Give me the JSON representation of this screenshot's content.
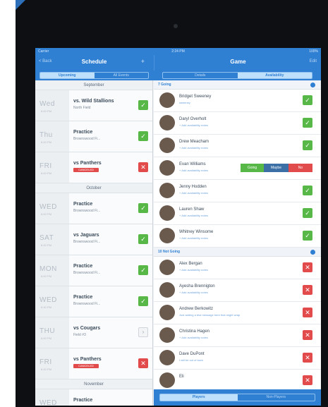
{
  "status": {
    "carrier": "Carrier",
    "time": "2:24 PM",
    "battery": "100%"
  },
  "nav": {
    "back_label": "< Back",
    "schedule_title": "Schedule",
    "add_icon": "plus-icon",
    "game_title": "Game",
    "edit_label": "Edit"
  },
  "schedule_tabs": [
    {
      "label": "Upcoming",
      "active": true
    },
    {
      "label": "All Events",
      "active": false
    }
  ],
  "game_tabs": [
    {
      "label": "Details",
      "active": false
    },
    {
      "label": "Availability",
      "active": true
    }
  ],
  "months": {
    "m1": "September",
    "m2": "October",
    "m3": "November"
  },
  "events": [
    {
      "day": "Wed",
      "time": "6:00 PM",
      "name": "vs. Wild Stallions",
      "loc": "North Field",
      "tag": "",
      "status": "yes"
    },
    {
      "day": "Thu",
      "time": "6:00 PM",
      "name": "Practice",
      "loc": "Brownswood Fi...",
      "tag": "",
      "status": "yes"
    },
    {
      "day": "FRI",
      "time": "6:00 PM",
      "name": "vs Panthers",
      "loc": "",
      "tag": "CANCELED",
      "status": "no"
    },
    {
      "day": "WED",
      "time": "6:00 PM",
      "name": "Practice",
      "loc": "Brownswood Fi...",
      "tag": "",
      "status": "yes"
    },
    {
      "day": "SAT",
      "time": "6:00 PM",
      "name": "vs Jaguars",
      "loc": "Brownswood Fi...",
      "tag": "",
      "status": "yes"
    },
    {
      "day": "MON",
      "time": "6:00 PM",
      "name": "Practice",
      "loc": "Brownswood Fi...",
      "tag": "",
      "status": "yes"
    },
    {
      "day": "WED",
      "time": "6:30 PM",
      "name": "Practice",
      "loc": "Brownswood Fi...",
      "tag": "",
      "status": "yes"
    },
    {
      "day": "THU",
      "time": "6:00 PM",
      "name": "vs Cougars",
      "loc": "Field #3",
      "tag": "",
      "status": "none"
    },
    {
      "day": "FRI",
      "time": "6:00 PM",
      "name": "vs Panthers",
      "loc": "",
      "tag": "CANCELED",
      "status": "no"
    },
    {
      "day": "WED",
      "time": "",
      "name": "Practice",
      "loc": "",
      "tag": "",
      "status": ""
    }
  ],
  "going_header": "7 Going",
  "not_going_header": "10 Not Going",
  "going": [
    {
      "name": "Bridget Sweeney",
      "email": "sweeney"
    },
    {
      "name": "Daryl Overholt",
      "email": "+ Add availability notes"
    },
    {
      "name": "Drew Meacham",
      "email": "+ Add availability notes"
    },
    {
      "name": "Evan Williams",
      "email": "+ Add availability notes"
    },
    {
      "name": "Jenny Hodden",
      "email": "+ Add availability notes"
    },
    {
      "name": "Lauren Shaw",
      "email": "+ Add availability notes"
    },
    {
      "name": "Whitney Winsome",
      "email": "+ Add availability notes"
    }
  ],
  "availability_buttons": {
    "going": "Going",
    "maybe": "Maybe",
    "no": "No"
  },
  "not_going": [
    {
      "name": "Alex Bergan",
      "email": "+ Add availability notes"
    },
    {
      "name": "Ayesha Brennigton",
      "email": "+ Add availability notes"
    },
    {
      "name": "Andrew Berkowitz",
      "email": "Just adding a test message here that might wrap"
    },
    {
      "name": "Christina Hagen",
      "email": "+ Add availability notes"
    },
    {
      "name": "Dave DuPont",
      "email": "I will be out of town"
    },
    {
      "name": "Eli",
      "email": ""
    }
  ],
  "bottom_tabs": [
    {
      "label": "Players",
      "active": true
    },
    {
      "label": "Non-Players",
      "active": false
    }
  ],
  "colors": {
    "primary": "#2f7fd2",
    "going": "#57b847",
    "not_going": "#e24b4b",
    "maybe": "#3b6fa6"
  }
}
